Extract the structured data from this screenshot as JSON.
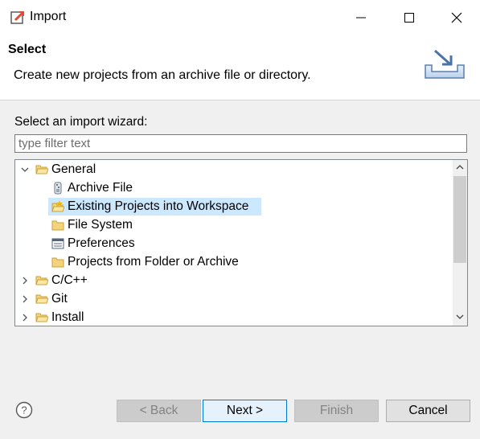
{
  "window": {
    "title": "Import",
    "controls": {
      "minimize": "minimize",
      "maximize": "maximize",
      "close": "close"
    }
  },
  "header": {
    "title": "Select",
    "description": "Create new projects from an archive file or directory.",
    "icon": "import-wizard-icon"
  },
  "wizard": {
    "label": "Select an import wizard:",
    "filter_placeholder": "type filter text",
    "filter_value": "",
    "tree": [
      {
        "label": "General",
        "level": 0,
        "expanded": true,
        "icon": "folder-open-icon"
      },
      {
        "label": "Archive File",
        "level": 1,
        "icon": "archive-file-icon"
      },
      {
        "label": "Existing Projects into Workspace",
        "level": 1,
        "icon": "existing-projects-icon",
        "selected": true
      },
      {
        "label": "File System",
        "level": 1,
        "icon": "folder-icon"
      },
      {
        "label": "Preferences",
        "level": 1,
        "icon": "preferences-icon"
      },
      {
        "label": "Projects from Folder or Archive",
        "level": 1,
        "icon": "folder-icon"
      },
      {
        "label": "C/C++",
        "level": 0,
        "expanded": false,
        "icon": "folder-open-icon"
      },
      {
        "label": "Git",
        "level": 0,
        "expanded": false,
        "icon": "folder-open-icon"
      },
      {
        "label": "Install",
        "level": 0,
        "expanded": false,
        "icon": "folder-open-icon"
      }
    ]
  },
  "footer": {
    "help_icon": "help-icon",
    "back": "< Back",
    "next": "Next >",
    "finish": "Finish",
    "cancel": "Cancel"
  },
  "colors": {
    "selection": "#cce8ff",
    "default_button_border": "#0078d7",
    "window_bg": "#f0f0f0"
  }
}
